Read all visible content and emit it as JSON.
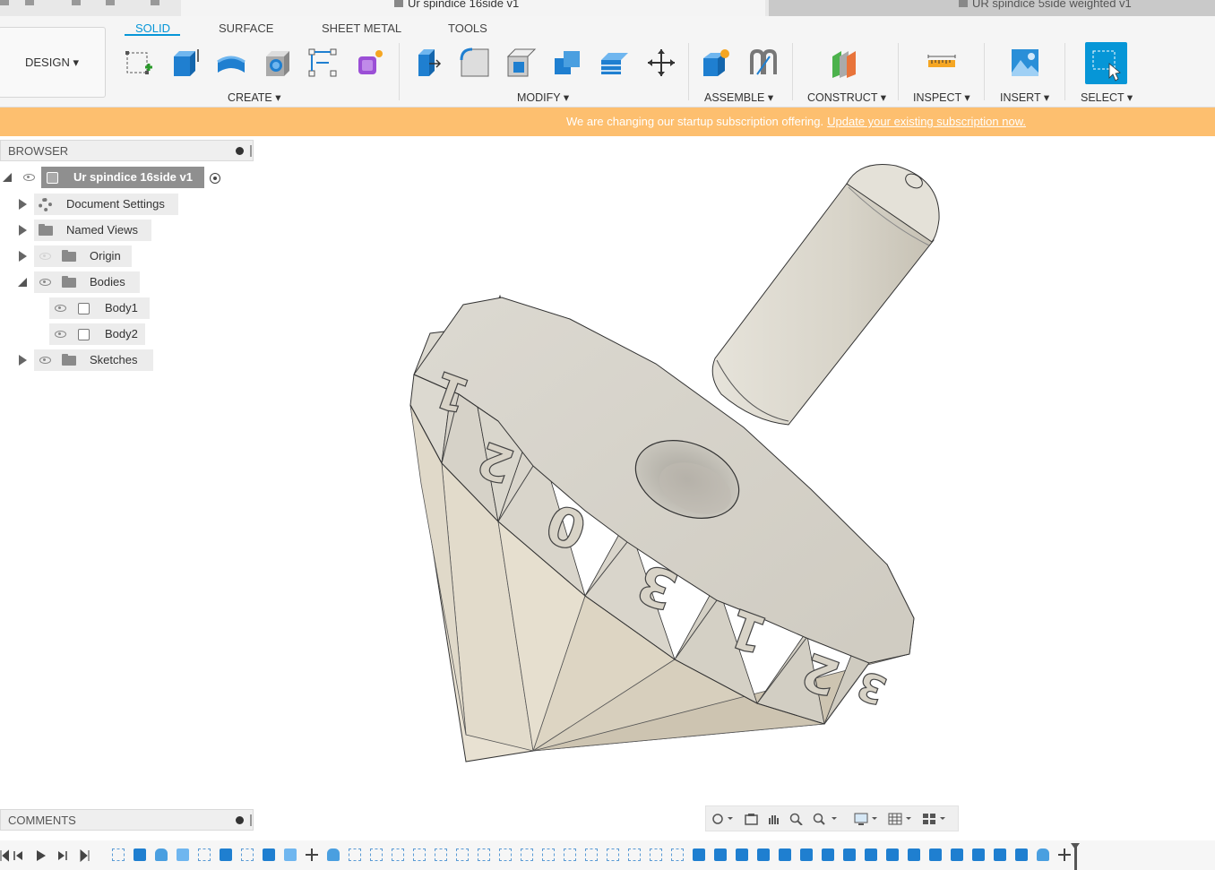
{
  "document_tabs": {
    "active": "Ur spindice 16side v1",
    "inactive": "UR spindice 5side weighted v1"
  },
  "toolbar": {
    "workspace_label": "DESIGN ▾",
    "mode_tabs": [
      "SOLID",
      "SURFACE",
      "SHEET METAL",
      "TOOLS"
    ],
    "active_mode": "SOLID",
    "groups": {
      "create": "CREATE ▾",
      "modify": "MODIFY ▾",
      "assemble": "ASSEMBLE ▾",
      "construct": "CONSTRUCT ▾",
      "inspect": "INSPECT ▾",
      "insert": "INSERT ▾",
      "select": "SELECT ▾"
    },
    "accent_color": "#0696d7"
  },
  "banner": {
    "text": "We are changing our startup subscription offering.",
    "link": "Update your existing subscription now.",
    "background": "#fdbf6f"
  },
  "browser": {
    "title": "BROWSER",
    "root": "Ur spindice 16side v1",
    "items": {
      "document_settings": "Document Settings",
      "named_views": "Named Views",
      "origin": "Origin",
      "bodies": "Bodies",
      "body1": "Body1",
      "body2": "Body2",
      "sketches": "Sketches"
    }
  },
  "model": {
    "face_numbers": [
      "1",
      "2",
      "0",
      "3",
      "1",
      "2",
      "3"
    ],
    "body_color": "#d9d4c8"
  },
  "comments": {
    "title": "COMMENTS"
  }
}
